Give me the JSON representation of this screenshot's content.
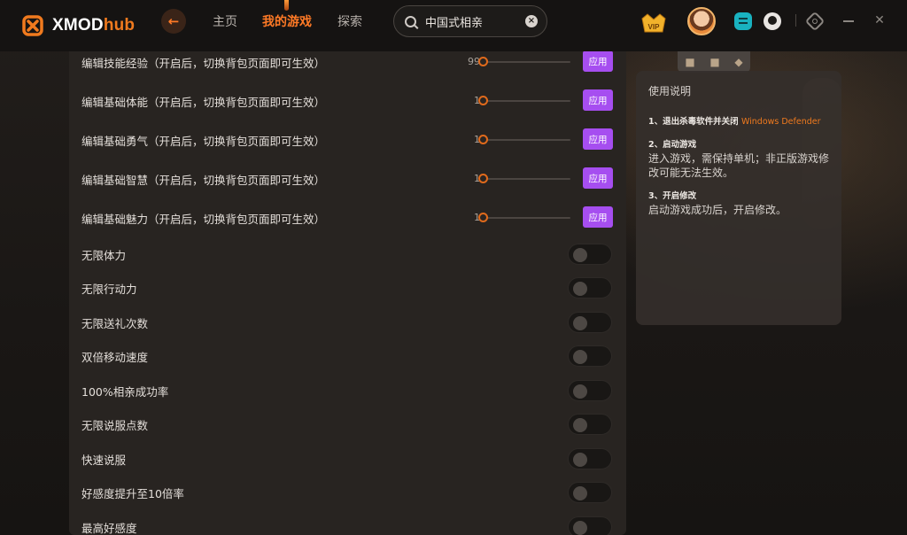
{
  "app": {
    "logo_main": "XMOD",
    "logo_suffix": "hub"
  },
  "nav": {
    "home": "主页",
    "my_games": "我的游戏",
    "explore": "探索"
  },
  "search": {
    "value": "中国式相亲"
  },
  "icons": {
    "back": "arrow-left-icon",
    "search": "search-icon",
    "clear": "clear-icon",
    "vip": "vip-crown-icon",
    "discord": "discord-icon",
    "qq": "qq-icon",
    "settings": "settings-icon",
    "minimize": "minimize-icon",
    "close": "close-icon"
  },
  "colors": {
    "accent": "#ff7a26",
    "apply_button": "#a64ef0",
    "panel": "#282421",
    "bar": "#151312"
  },
  "sliders": [
    {
      "label": "编辑技能经验（开启后，切换背包页面即可生效）",
      "value": "99",
      "button": "应用"
    },
    {
      "label": "编辑基础体能（开启后，切换背包页面即可生效）",
      "value": "1",
      "button": "应用"
    },
    {
      "label": "编辑基础勇气（开启后，切换背包页面即可生效）",
      "value": "1",
      "button": "应用"
    },
    {
      "label": "编辑基础智慧（开启后，切换背包页面即可生效）",
      "value": "1",
      "button": "应用"
    },
    {
      "label": "编辑基础魅力（开启后，切换背包页面即可生效）",
      "value": "1",
      "button": "应用"
    }
  ],
  "toggles": [
    {
      "label": "无限体力",
      "on": false
    },
    {
      "label": "无限行动力",
      "on": false
    },
    {
      "label": "无限送礼次数",
      "on": false
    },
    {
      "label": "双倍移动速度",
      "on": false
    },
    {
      "label": "100%相亲成功率",
      "on": false
    },
    {
      "label": "无限说服点数",
      "on": false
    },
    {
      "label": "快速说服",
      "on": false
    },
    {
      "label": "好感度提升至10倍率",
      "on": false
    },
    {
      "label": "最高好感度",
      "on": false
    }
  ],
  "help": {
    "title": "使用说明",
    "step1_head": "1、退出杀毒软件并关闭",
    "step1_accent": "Windows Defender",
    "step2_head": "2、启动游戏",
    "step2_body": "进入游戏，需保持单机；非正版游戏修改可能无法生效。",
    "step3_head": "3、开启修改",
    "step3_body": "启动游戏成功后，开启修改。"
  }
}
